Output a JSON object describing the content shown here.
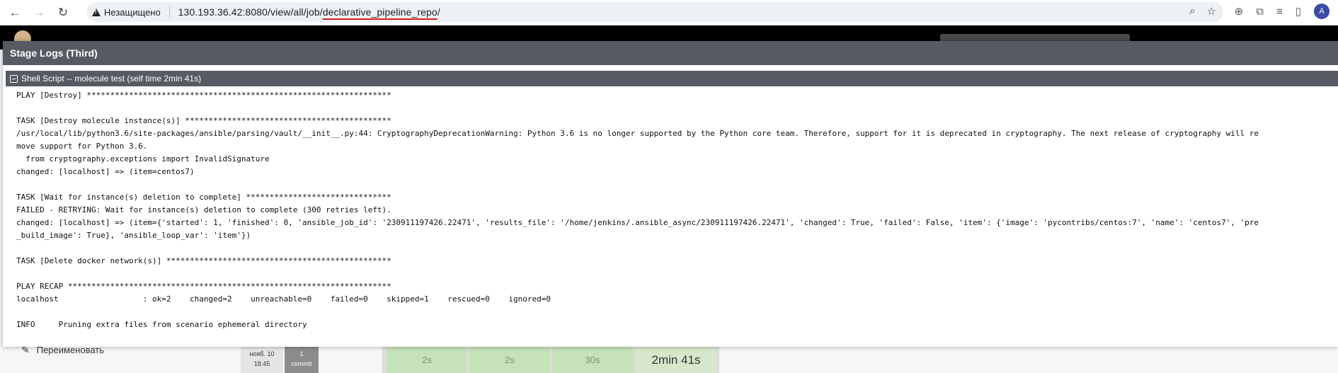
{
  "browser": {
    "back_icon": "←",
    "forward_icon": "→",
    "reload_icon": "↻",
    "security_label": "Незащищено",
    "url_host": "130.193.36.42:8080",
    "url_path_before": "/view/all/job/",
    "url_highlight": "declarative_pipeline_repo",
    "url_path_after": "/",
    "zoom_icon": "⌕",
    "star_icon": "☆",
    "profile_initial": "A"
  },
  "jenkins": {
    "sidebar_rename": "Переименовать",
    "build_date": "нояб. 10",
    "build_time": "18:45",
    "commit_count": "1",
    "commit_label": "commit",
    "stage_times": [
      "2s",
      "2s",
      "30s",
      "2min 41s"
    ]
  },
  "modal": {
    "title": "Stage Logs (Third)",
    "step_title": "Shell Script -- molecule test (self time 2min 41s)"
  },
  "log_lines": [
    "PLAY [Destroy] *****************************************************************",
    "",
    "TASK [Destroy molecule instance(s)] ********************************************",
    "/usr/local/lib/python3.6/site-packages/ansible/parsing/vault/__init__.py:44: CryptographyDeprecationWarning: Python 3.6 is no longer supported by the Python core team. Therefore, support for it is deprecated in cryptography. The next release of cryptography will re",
    "move support for Python 3.6.",
    "  from cryptography.exceptions import InvalidSignature",
    "changed: [localhost] => (item=centos7)",
    "",
    "TASK [Wait for instance(s) deletion to complete] *******************************",
    "FAILED - RETRYING: Wait for instance(s) deletion to complete (300 retries left).",
    "changed: [localhost] => (item={'started': 1, 'finished': 0, 'ansible_job_id': '230911197426.22471', 'results_file': '/home/jenkins/.ansible_async/230911197426.22471', 'changed': True, 'failed': False, 'item': {'image': 'pycontribs/centos:7', 'name': 'centos7', 'pre",
    "_build_image': True}, 'ansible_loop_var': 'item'})",
    "",
    "TASK [Delete docker network(s)] ************************************************",
    "",
    "PLAY RECAP *********************************************************************",
    "localhost                  : ok=2    changed=2    unreachable=0    failed=0    skipped=1    rescued=0    ignored=0",
    "",
    "INFO     Pruning extra files from scenario ephemeral directory"
  ]
}
